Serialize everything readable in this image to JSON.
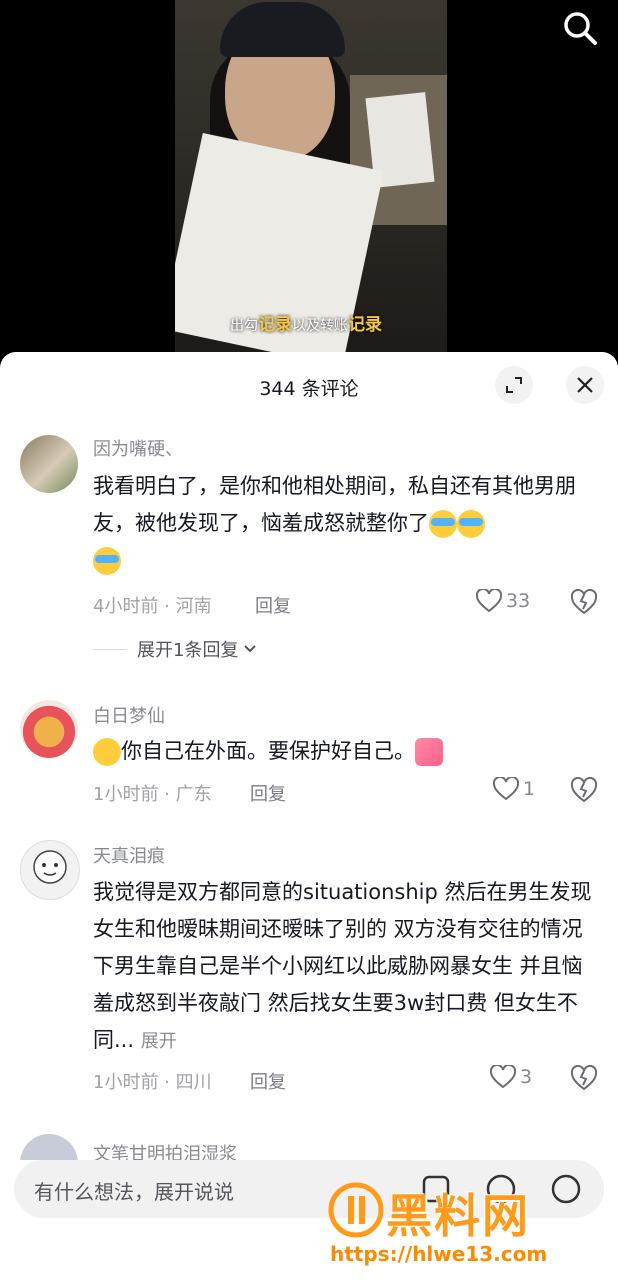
{
  "video": {
    "subtitle_pre": "出勾",
    "subtitle_hl1": "记录",
    "subtitle_mid": "以及转账",
    "subtitle_hl2": "记录",
    "search_icon": "search-icon"
  },
  "sheet": {
    "title": "344 条评论",
    "expand_icon": "fullscreen-icon",
    "close_icon": "close-icon"
  },
  "comments": [
    {
      "name": "因为嘴硬、",
      "text": "我看明白了，是你和他相处期间，私自还有其他男朋友，被他发现了，恼羞成怒就整你了",
      "meta": "4小时前 · 河南",
      "reply": "回复",
      "likes": "33",
      "more_replies": "展开1条回复"
    },
    {
      "name": "白日梦仙",
      "text": "你自己在外面。要保护好自己。",
      "meta": "1小时前 · 广东",
      "reply": "回复",
      "likes": "1"
    },
    {
      "name": "天真泪痕",
      "text": "我觉得是双方都同意的situationship 然后在男生发现女生和他暧昧期间还暧昧了别的 双方没有交往的情况下男生靠自己是半个小网红以此威胁网暴女生 并且恼羞成怒到半夜敲门 然后找女生要3w封口费 但女生不同...",
      "more": "展开",
      "meta": "1小时前 · 四川",
      "reply": "回复",
      "likes": "3"
    }
  ],
  "next_partial_name": "文笔甘明拍泪湿浆",
  "input": {
    "placeholder": "有什么想法，展开说说"
  },
  "watermark": {
    "title": "黑料网",
    "url": "https://hlwe13.com"
  }
}
